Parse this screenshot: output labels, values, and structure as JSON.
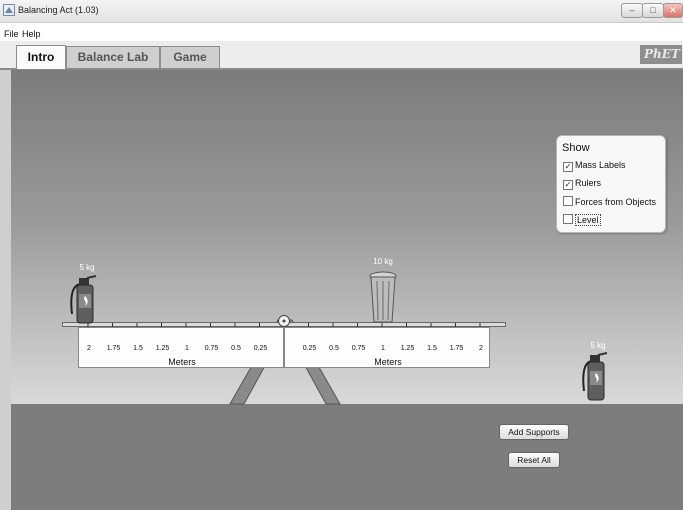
{
  "window": {
    "title": "Balancing Act (1.03)",
    "controls": [
      "minimize",
      "maximize",
      "close"
    ]
  },
  "menu": [
    "File",
    "Help"
  ],
  "tabs": [
    {
      "label": "Intro",
      "active": true
    },
    {
      "label": "Balance Lab",
      "active": false
    },
    {
      "label": "Game",
      "active": false
    }
  ],
  "logo_text": "PhET",
  "show_panel": {
    "title": "Show",
    "options": [
      {
        "label": "Mass Labels",
        "checked": true
      },
      {
        "label": "Rulers",
        "checked": true
      },
      {
        "label": "Forces from Objects",
        "checked": false
      },
      {
        "label": "Level",
        "checked": false
      }
    ]
  },
  "masses": {
    "left_extinguisher": "5 kg",
    "trash_can": "10 kg",
    "tray_extinguisher": "5 kg"
  },
  "ruler": {
    "left_ticks": [
      "2",
      "1.75",
      "1.5",
      "1.25",
      "1",
      "0.75",
      "0.5",
      "0.25"
    ],
    "right_ticks": [
      "0.25",
      "0.5",
      "0.75",
      "1",
      "1.25",
      "1.5",
      "1.75",
      "2"
    ],
    "unit_label": "Meters"
  },
  "buttons": {
    "add_supports": "Add Supports",
    "reset_all": "Reset All"
  },
  "colors": {
    "sky_top": "#7b7b7b",
    "ground": "#7d7d7d",
    "panel_bg": "#f8f8f8"
  }
}
